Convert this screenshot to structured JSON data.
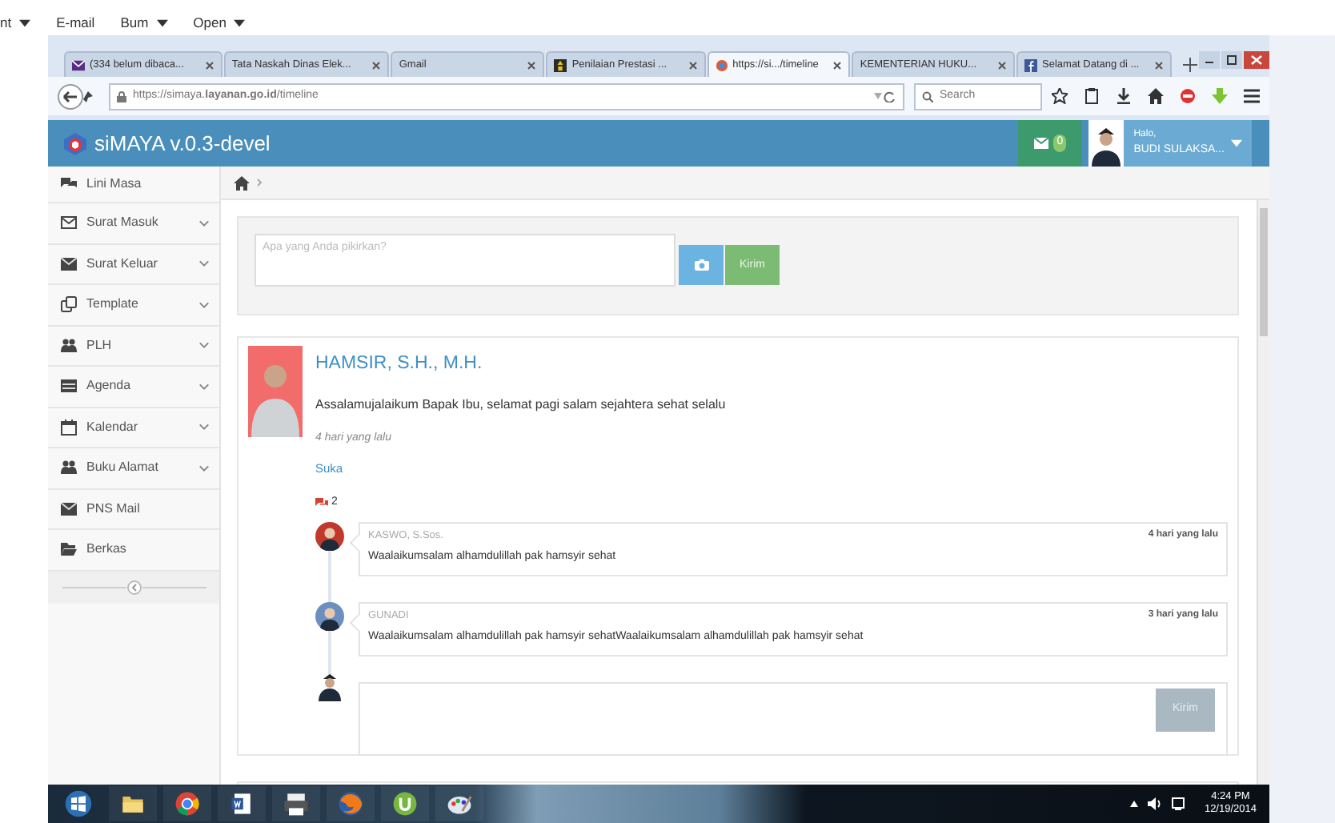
{
  "os_menu": [
    {
      "label": "nt",
      "caret": true
    },
    {
      "label": "E-mail",
      "caret": false
    },
    {
      "label": "Bum",
      "caret": true
    },
    {
      "label": "Open",
      "caret": true
    }
  ],
  "browser": {
    "tabs": [
      {
        "title": "(334 belum dibaca...",
        "selected": false
      },
      {
        "title": "Tata Naskah Dinas Elek...",
        "selected": false
      },
      {
        "title": "Gmail",
        "selected": false
      },
      {
        "title": "Penilaian Prestasi ...",
        "selected": false
      },
      {
        "title": "https://si.../timeline",
        "selected": true
      },
      {
        "title": "KEMENTERIAN HUKU...",
        "selected": false
      },
      {
        "title": "Selamat Datang di ...",
        "selected": false
      }
    ],
    "url": "https://simaya.**layanan.go.id**/timeline",
    "search_placeholder": "Search"
  },
  "app": {
    "brand": "siMAYA v.0.3-devel",
    "mail_count": "0",
    "greeting": "Halo,",
    "user": "BUDI SULAKSA..."
  },
  "sidebar": {
    "items": [
      {
        "label": "Lini Masa",
        "submenu": false
      },
      {
        "label": "Surat Masuk",
        "submenu": true
      },
      {
        "label": "Surat Keluar",
        "submenu": true
      },
      {
        "label": "Template",
        "submenu": true
      },
      {
        "label": "PLH",
        "submenu": true
      },
      {
        "label": "Agenda",
        "submenu": true
      },
      {
        "label": "Kalendar",
        "submenu": true
      },
      {
        "label": "Buku Alamat",
        "submenu": true
      },
      {
        "label": "PNS Mail",
        "submenu": false
      },
      {
        "label": "Berkas",
        "submenu": false
      }
    ]
  },
  "composer": {
    "placeholder": "Apa yang Anda pikirkan?",
    "button": "Kirim"
  },
  "post": {
    "author": "HAMSIR, S.H., M.H.",
    "text": "Assalamujalaikum Bapak Ibu, selamat pagi salam sejahtera sehat selalu",
    "time": "4 hari yang lalu",
    "like": "Suka",
    "comment_count": "2",
    "comments": [
      {
        "author": "KASWO, S.Sos.",
        "time": "4 hari yang lalu",
        "text": "Waalaikumsalam alhamdulillah pak hamsyir sehat"
      },
      {
        "author": "GUNADI",
        "time": "3 hari yang lalu",
        "text": "Waalaikumsalam alhamdulillah pak hamsyir sehatWaalaikumsalam alhamdulillah pak hamsyir sehat"
      }
    ],
    "reply_button": "Kirim"
  },
  "taskbar": {
    "time": "4:24 PM",
    "date": "12/19/2014"
  }
}
